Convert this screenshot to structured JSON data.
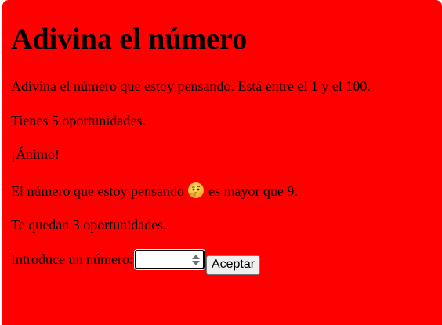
{
  "game": {
    "title": "Adivina el número",
    "instructions": "Adivina el número que estoy pensando. Está entre el 1 y el 100.",
    "chances": "Tienes 5 oportunidades.",
    "encouragement": "¡Ánimo!",
    "feedback_prefix": "El número que estoy pensando",
    "feedback_emoji": "thinking-face-emoji",
    "feedback_suffix": "es mayor que 9.",
    "remaining": "Te quedan 3 oportunidades.",
    "input_label": "Introduce un número:",
    "input_value": "",
    "accept_label": "Aceptar"
  },
  "colors": {
    "background": "#ff0000",
    "text": "#000000"
  }
}
